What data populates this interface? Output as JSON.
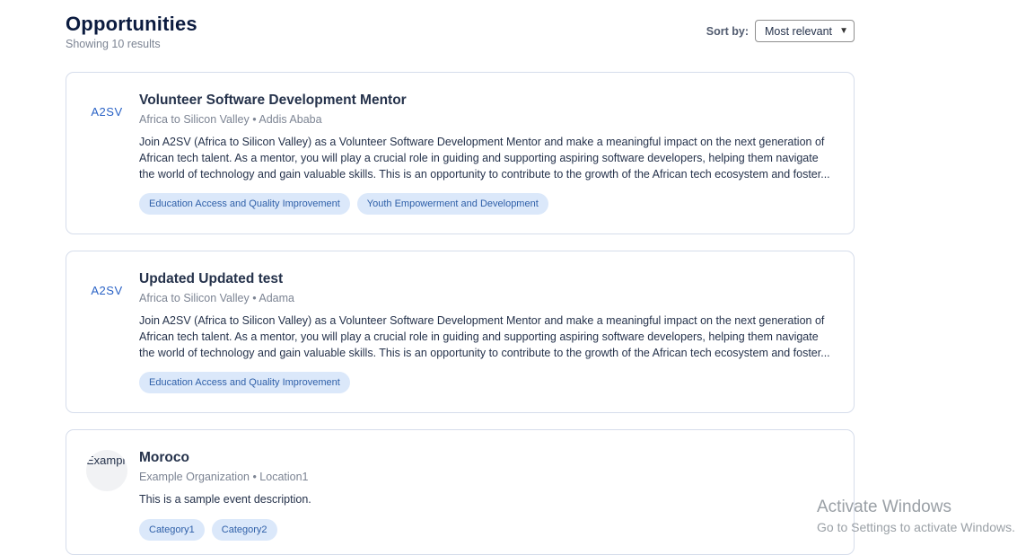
{
  "header": {
    "title": "Opportunities",
    "results_text": "Showing 10 results",
    "sort_label": "Sort by:",
    "sort_value": "Most relevant"
  },
  "cards": [
    {
      "logo_text": "A2SV",
      "title": "Volunteer Software Development Mentor",
      "organization": "Africa to Silicon Valley",
      "location": "Addis Ababa",
      "meta": "Africa to Silicon Valley • Addis Ababa",
      "description": "Join A2SV (Africa to Silicon Valley) as a Volunteer Software Development Mentor and make a meaningful impact on the next generation of African tech talent. As a mentor, you will play a crucial role in guiding and supporting aspiring software developers, helping them navigate the world of technology and gain valuable skills. This is an opportunity to contribute to the growth of the African tech ecosystem and foster...",
      "tags": [
        "Education Access and Quality Improvement",
        "Youth Empowerment and Development"
      ]
    },
    {
      "logo_text": "A2SV",
      "title": "Updated Updated test",
      "organization": "Africa to Silicon Valley",
      "location": "Adama",
      "meta": "Africa to Silicon Valley • Adama",
      "description": "Join A2SV (Africa to Silicon Valley) as a Volunteer Software Development Mentor and make a meaningful impact on the next generation of African tech talent. As a mentor, you will play a crucial role in guiding and supporting aspiring software developers, helping them navigate the world of technology and gain valuable skills. This is an opportunity to contribute to the growth of the African tech ecosystem and foster...",
      "tags": [
        "Education Access and Quality Improvement"
      ]
    },
    {
      "logo_text": "Exampl",
      "title": "Moroco",
      "organization": "Example Organization",
      "location": "Location1",
      "meta": "Example Organization • Location1",
      "description": "This is a sample event description.",
      "tags": [
        "Category1",
        "Category2"
      ]
    }
  ],
  "watermark": {
    "line1": "Activate Windows",
    "line2": "Go to Settings to activate Windows."
  },
  "colors": {
    "title": "#0b1b3f",
    "tag_bg": "#dbe8fa",
    "tag_text": "#2e5fa8",
    "card_border": "#d6ddeb"
  }
}
